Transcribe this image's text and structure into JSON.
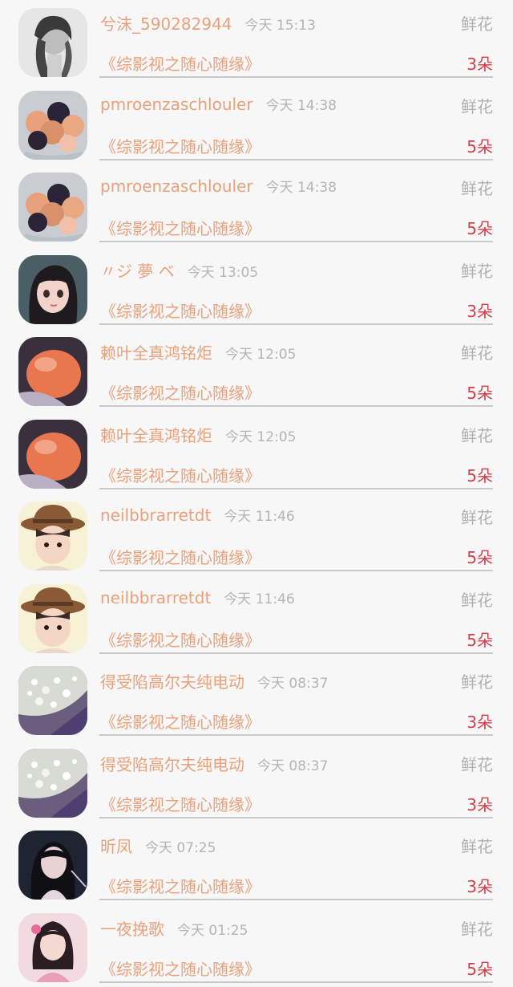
{
  "records": [
    {
      "username": "兮沫_590282944",
      "time": "今天 15:13",
      "gift_type": "鲜花",
      "book": "《综影视之随心随缘》",
      "amount": "3朵",
      "avatar": "girl-bw-avatar-icon"
    },
    {
      "username": "pmroenzaschlouler",
      "time": "今天 14:38",
      "gift_type": "鲜花",
      "book": "《综影视之随心随缘》",
      "amount": "5朵",
      "avatar": "rose-bouquet-avatar-icon"
    },
    {
      "username": "pmroenzaschlouler",
      "time": "今天 14:38",
      "gift_type": "鲜花",
      "book": "《综影视之随心随缘》",
      "amount": "5朵",
      "avatar": "rose-bouquet-avatar-icon"
    },
    {
      "username": "〃ジ 夢 ベ",
      "time": "今天 13:05",
      "gift_type": "鲜花",
      "book": "《综影视之随心随缘》",
      "amount": "3朵",
      "avatar": "anime-girl-avatar-icon"
    },
    {
      "username": "赖叶全真鸿铭炬",
      "time": "今天 12:05",
      "gift_type": "鲜花",
      "book": "《综影视之随心随缘》",
      "amount": "5朵",
      "avatar": "orange-stone-avatar-icon"
    },
    {
      "username": "赖叶全真鸿铭炬",
      "time": "今天 12:05",
      "gift_type": "鲜花",
      "book": "《综影视之随心随缘》",
      "amount": "5朵",
      "avatar": "orange-stone-avatar-icon"
    },
    {
      "username": "neilbbrarretdt",
      "time": "今天 11:46",
      "gift_type": "鲜花",
      "book": "《综影视之随心随缘》",
      "amount": "5朵",
      "avatar": "child-hat-avatar-icon"
    },
    {
      "username": "neilbbrarretdt",
      "time": "今天 11:46",
      "gift_type": "鲜花",
      "book": "《综影视之随心随缘》",
      "amount": "5朵",
      "avatar": "child-hat-avatar-icon"
    },
    {
      "username": "得受陷高尔夫纯电动",
      "time": "今天 08:37",
      "gift_type": "鲜花",
      "book": "《综影视之随心随缘》",
      "amount": "3朵",
      "avatar": "babys-breath-avatar-icon"
    },
    {
      "username": "得受陷高尔夫纯电动",
      "time": "今天 08:37",
      "gift_type": "鲜花",
      "book": "《综影视之随心随缘》",
      "amount": "3朵",
      "avatar": "babys-breath-avatar-icon"
    },
    {
      "username": "昕凤",
      "time": "今天 07:25",
      "gift_type": "鲜花",
      "book": "《综影视之随心随缘》",
      "amount": "3朵",
      "avatar": "dark-hair-girl-avatar-icon"
    },
    {
      "username": "一夜挽歌",
      "time": "今天 01:25",
      "gift_type": "鲜花",
      "book": "《综影视之随心随缘》",
      "amount": "5朵",
      "avatar": "pink-girl-avatar-icon"
    }
  ],
  "colors": {
    "background": "#f7f7f7",
    "name": "#e9a17b",
    "book": "#e9a17b",
    "time": "#b4b4b4",
    "gift_type": "#b0b0b0",
    "amount": "#d2404a",
    "divider": "#c9c9c9"
  }
}
